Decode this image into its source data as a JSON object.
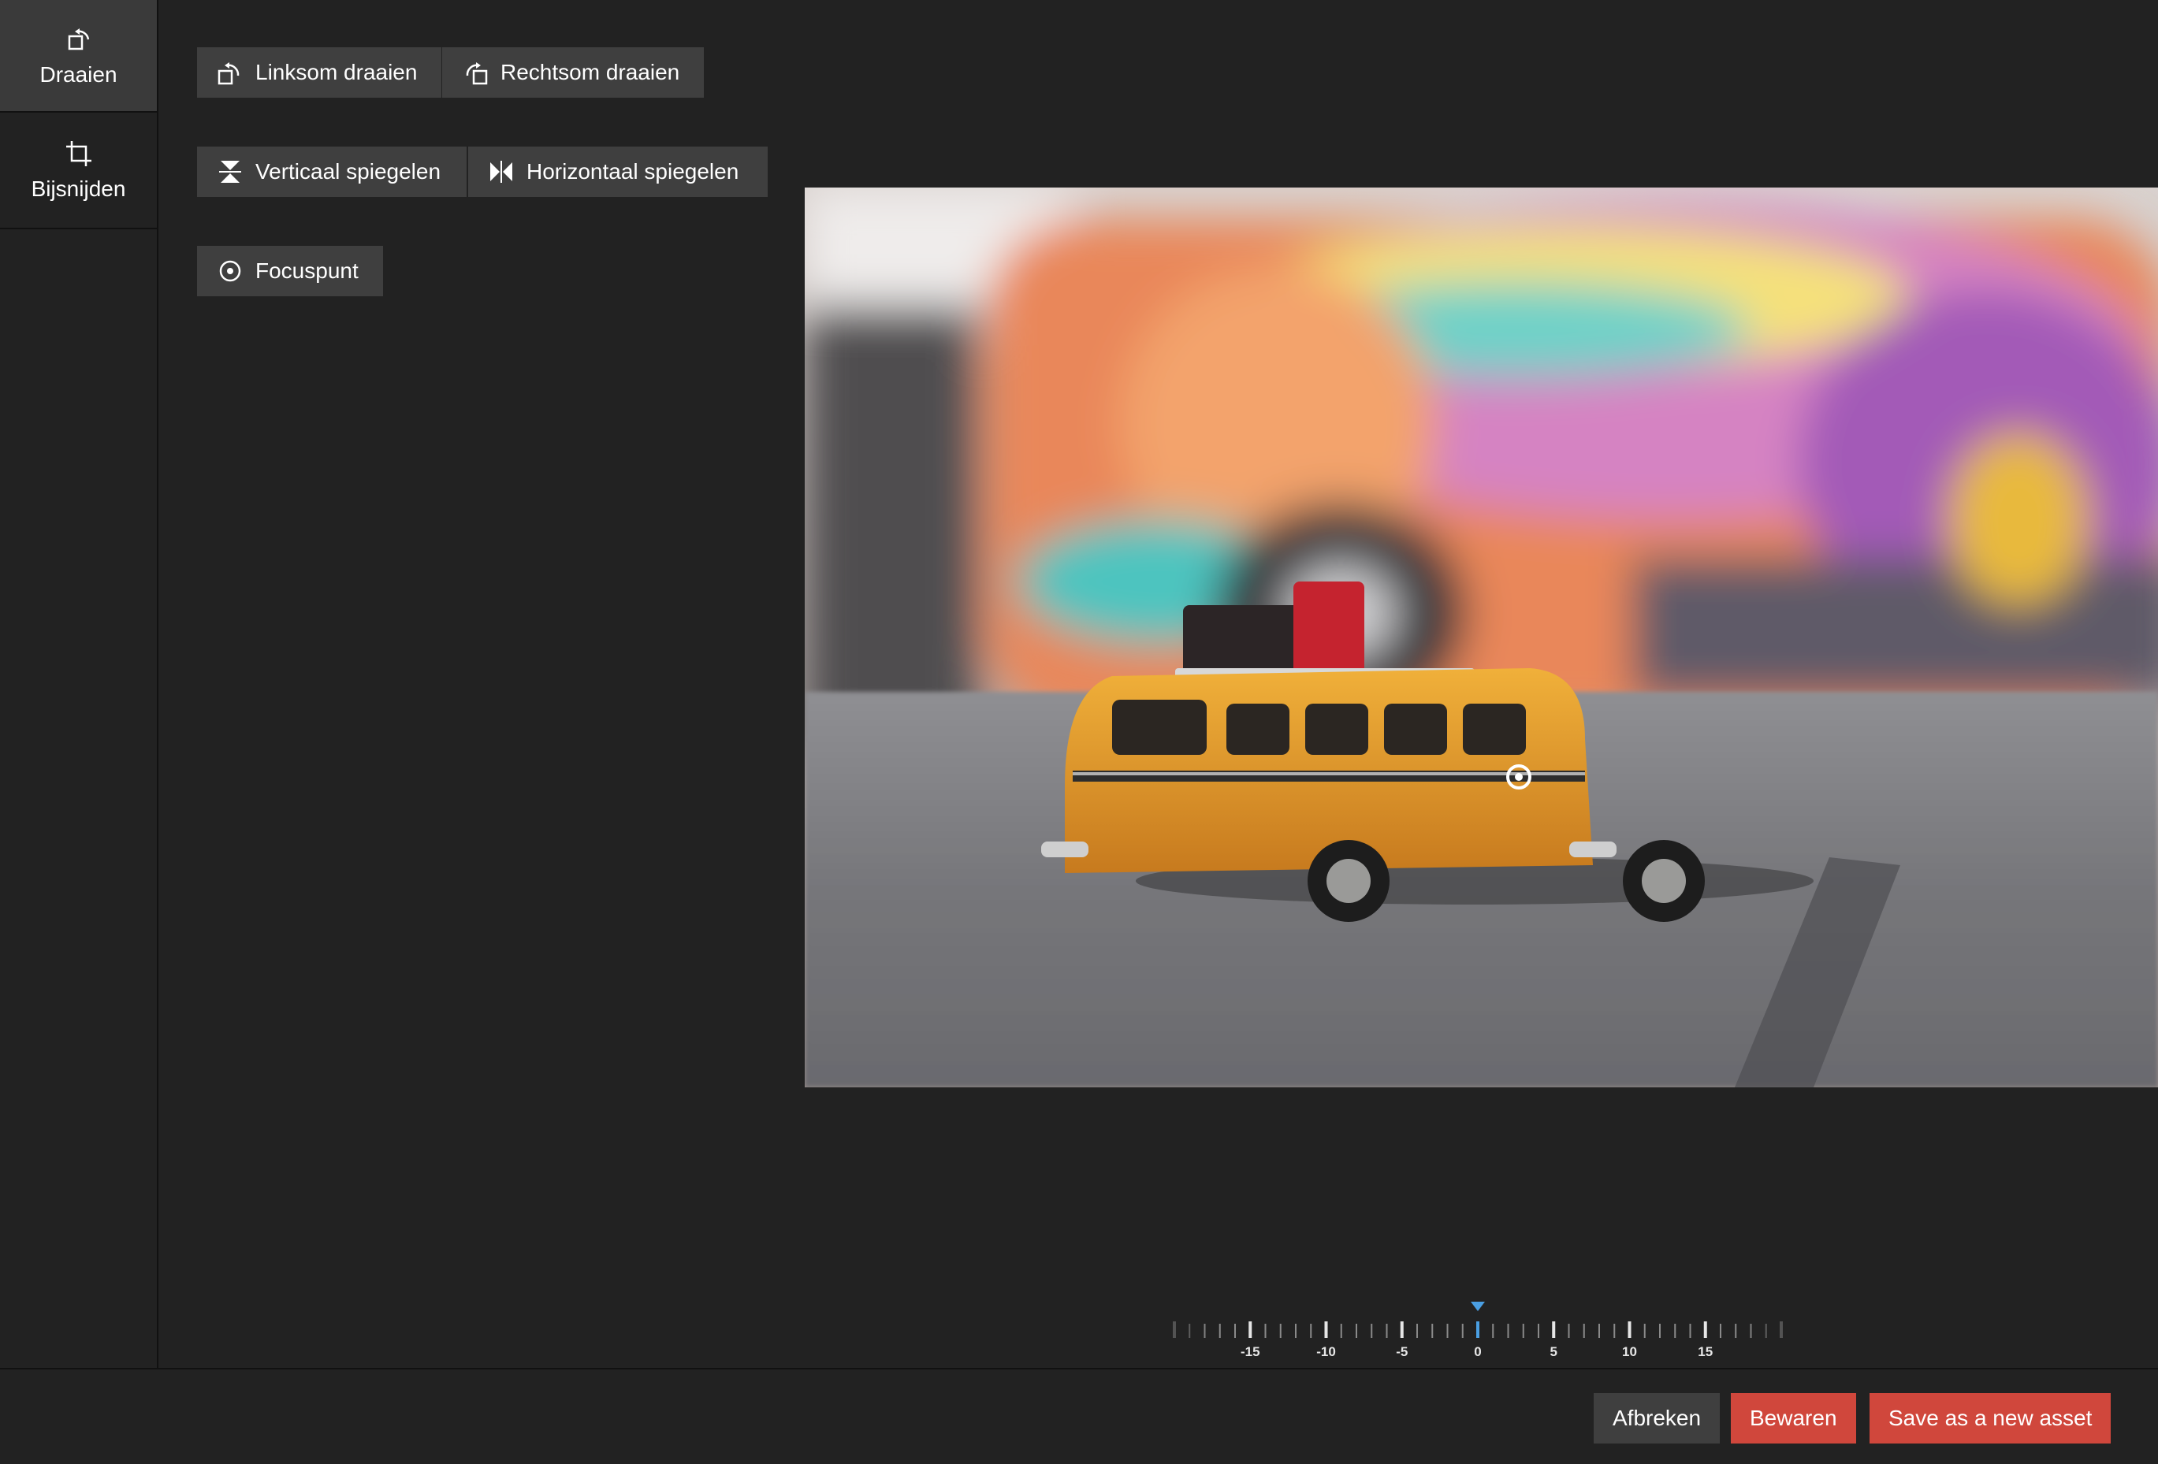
{
  "sidebar": {
    "tabs": [
      {
        "label": "Draaien",
        "icon": "rotate-icon",
        "active": true
      },
      {
        "label": "Bijsnijden",
        "icon": "crop-icon",
        "active": false
      }
    ]
  },
  "toolbar": {
    "rotate_left": "Linksom draaien",
    "rotate_right": "Rechtsom draaien",
    "flip_vertical": "Verticaal spiegelen",
    "flip_horizontal": "Horizontaal spiegelen",
    "focus_point": "Focuspunt"
  },
  "rotation": {
    "value": 0,
    "min": -20,
    "max": 20,
    "tick_labels": [
      "-15",
      "-10",
      "-5",
      "0",
      "5",
      "10",
      "15"
    ],
    "indicator_color": "#4a9fe3"
  },
  "footer": {
    "cancel": "Afbreken",
    "save": "Bewaren",
    "save_new": "Save as a new asset"
  },
  "colors": {
    "accent_red": "#d0473c",
    "button_gray": "#3f3f3f",
    "background": "#222222"
  }
}
